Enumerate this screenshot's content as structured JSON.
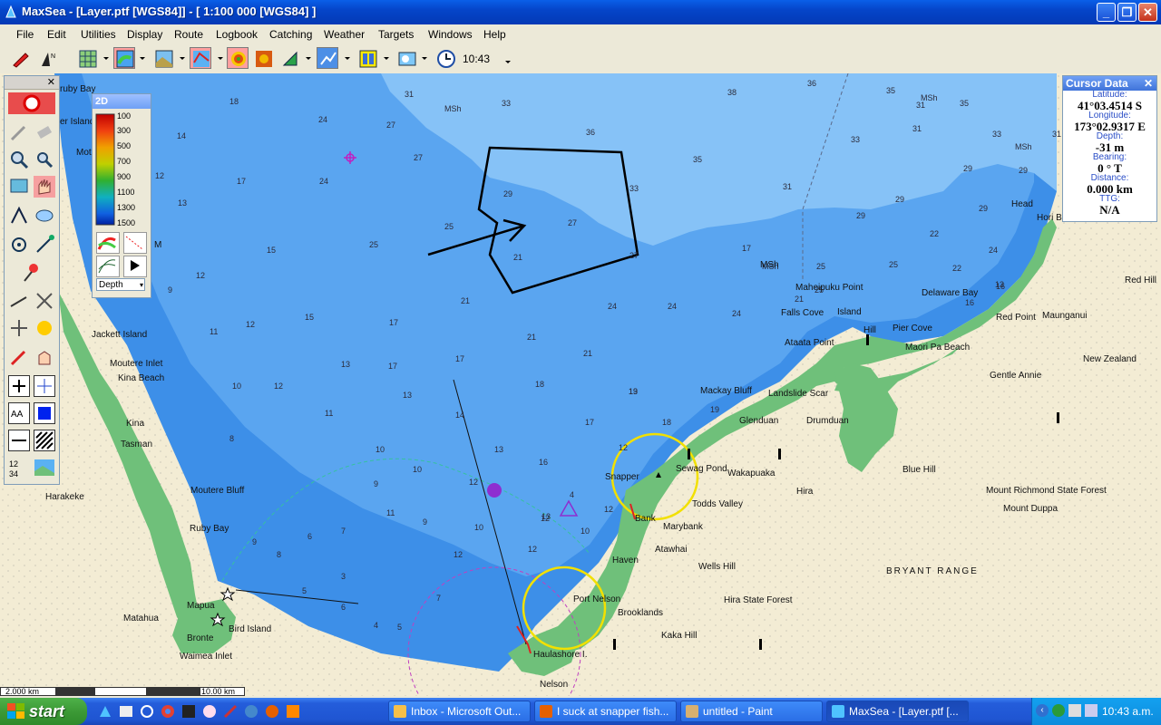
{
  "window": {
    "title": "MaxSea - [Layer.ptf [WGS84]] - [ 1:100 000 [WGS84] ]",
    "minimize": "_",
    "maximize": "❐",
    "close": "✕"
  },
  "menu": [
    "File",
    "Edit",
    "Utilities",
    "Display",
    "Route",
    "Logbook",
    "Catching",
    "Weather",
    "Targets",
    "Windows",
    "Help"
  ],
  "toolbar": {
    "clock": "10:43",
    "icons": [
      "pencil-eraser-icon",
      "north-arrow-icon",
      "grid-icon",
      "chart-layer-icon",
      "photo-layer-icon",
      "bathymetry-icon",
      "contour-icon",
      "3d-relief-icon",
      "route-flag-icon",
      "track-icon",
      "split-view-icon",
      "weather-image-icon",
      "clock-icon"
    ]
  },
  "legend": {
    "title": "2D",
    "scale": [
      "100",
      "300",
      "500",
      "700",
      "900",
      "1100",
      "1300",
      "1500"
    ],
    "mode_select": "Depth"
  },
  "cursor_data": {
    "title": "Cursor Data",
    "latitude_label": "Latitude:",
    "latitude": "41°03.4514 S",
    "longitude_label": "Longitude:",
    "longitude": "173°02.9317 E",
    "depth_label": "Depth:",
    "depth": "-31 m",
    "bearing_label": "Bearing:",
    "bearing": "0 ° T",
    "distance_label": "Distance:",
    "distance": "0.000 km",
    "ttg_label": "TTG:",
    "ttg": "N/A"
  },
  "scale": {
    "left": "2.000 km",
    "right": "10.00 km"
  },
  "places": [
    "Harakeke",
    "Moutere Bluff",
    "Ruby Bay",
    "Mapua",
    "Matahua",
    "Bird Island",
    "Bronte",
    "Waimea Inlet",
    "Haulashore I.",
    "Nelson",
    "Port Nelson",
    "Brooklands",
    "Kaka Hill",
    "Haven",
    "Atawhai",
    "Marybank",
    "Wells Hill",
    "Hira State Forest",
    "Todds Valley",
    "Sewag Pond",
    "Wakapuaka",
    "Hira",
    "Blue Hill",
    "Mount Richmond State Forest",
    "Mount Duppa",
    "BRYANT RANGE",
    "Glenduan",
    "Drumduan",
    "Mackay Bluff",
    "Landslide Scar",
    "Ataata Point",
    "Falls Cove",
    "Island",
    "Hill",
    "Pier Cove",
    "Maori Pa Beach",
    "Maheipuku Point",
    "Delaware Bay",
    "Red Point",
    "Maunganui",
    "Red Hill",
    "New Zealand",
    "Gentle Annie",
    "Head",
    "Hori B",
    "Jackett Island",
    "Moutere Inlet",
    "Kina Beach",
    "Kina",
    "Tasman",
    "Snapper",
    "Bank",
    "MSh",
    "ruby Bay",
    "er Island",
    "Mot",
    "M"
  ],
  "depths": [
    "31",
    "33",
    "38",
    "36",
    "35",
    "35",
    "MSh",
    "18",
    "24",
    "27",
    "36",
    "14",
    "27",
    "33",
    "31",
    "33",
    "31",
    "31",
    "MSh",
    "17",
    "24",
    "35",
    "31",
    "29",
    "MSh",
    "12",
    "29",
    "33",
    "13",
    "29",
    "29",
    "29",
    "29",
    "25",
    "22",
    "27",
    "25",
    "15",
    "24",
    "25",
    "21",
    "25",
    "22",
    "12",
    "17",
    "21",
    "27",
    "MSh",
    "25",
    "16",
    "9",
    "15",
    "21",
    "24",
    "24",
    "24",
    "12",
    "11",
    "17",
    "21",
    "21",
    "19",
    "12",
    "13",
    "17",
    "10",
    "18",
    "13",
    "17",
    "11",
    "13",
    "18",
    "10",
    "13",
    "14",
    "17",
    "19",
    "12",
    "10",
    "9",
    "12",
    "8",
    "7",
    "6",
    "9",
    "10",
    "11",
    "12",
    "9",
    "8",
    "5",
    "4",
    "3",
    "7",
    "6",
    "5",
    "4",
    "13",
    "12",
    "10",
    "12",
    "13",
    "12",
    "16",
    "16",
    "14",
    "13"
  ],
  "taskbar": {
    "start": "start",
    "tasks": [
      "Inbox - Microsoft Out...",
      "I suck at snapper fish...",
      "untitled - Paint",
      "MaxSea - [Layer.ptf [..."
    ],
    "time": "10:43 a.m."
  },
  "colors": {
    "deep_sea": "#7ab8f5",
    "mid_sea": "#5aa5f0",
    "shallow_sea": "#3d8fe8",
    "land": "#f3ecd4",
    "vegetation": "#6fc07a"
  }
}
